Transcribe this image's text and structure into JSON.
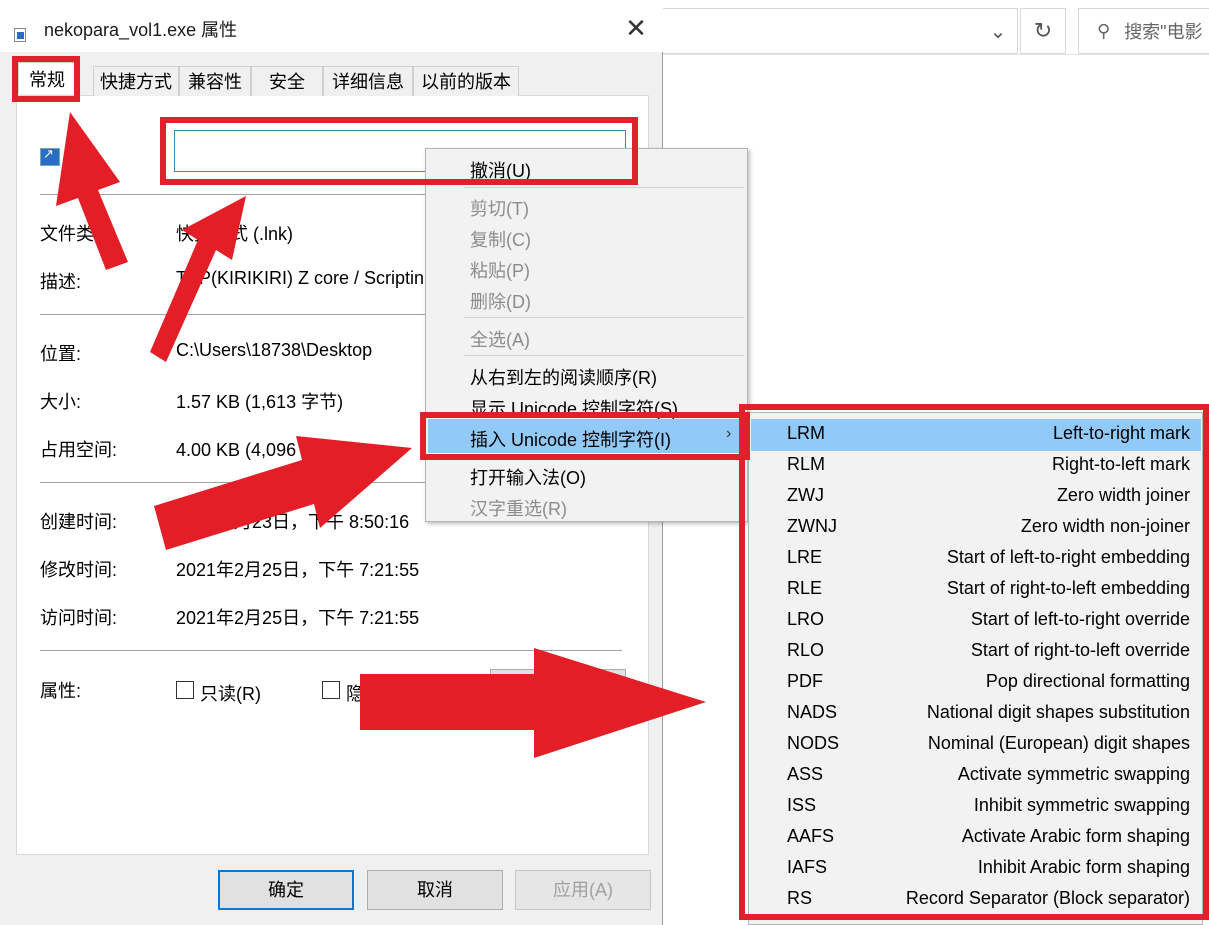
{
  "dialog": {
    "title": "nekopara_vol1.exe 属性",
    "close_glyph": "✕",
    "tabs": [
      "常规",
      "快捷方式",
      "兼容性",
      "安全",
      "详细信息",
      "以前的版本"
    ],
    "fields": {
      "file_type_label": "文件类",
      "file_type_value": "快捷方式 (.lnk)",
      "desc_label": "描述:",
      "desc_value": "TVP(KIRIKIRI) Z core / Scriptin",
      "location_label": "位置:",
      "location_value": "C:\\Users\\18738\\Desktop",
      "size_label": "大小:",
      "size_value": "1.57 KB (1,613 字节)",
      "disk_label": "占用空间:",
      "disk_value": "4.00 KB (4,096 字节)",
      "created_label": "创建时间:",
      "created_value": "2月23日，下午 8:50:16",
      "modified_label": "修改时间:",
      "modified_value": "2021年2月25日，下午 7:21:55",
      "accessed_label": "访问时间:",
      "accessed_value": "2021年2月25日，下午 7:21:55",
      "attr_label": "属性:",
      "readonly_label": "只读(R)",
      "hidden_label": "隐"
    },
    "buttons": {
      "ok": "确定",
      "cancel": "取消",
      "apply": "应用(A)"
    }
  },
  "explorer": {
    "chevron": "⌄",
    "refresh": "↻",
    "search_icon": "⚲",
    "search_placeholder": "搜索\"电影"
  },
  "context_menu": {
    "undo": "撤消(U)",
    "cut": "剪切(T)",
    "copy": "复制(C)",
    "paste": "粘贴(P)",
    "delete": "删除(D)",
    "select_all": "全选(A)",
    "rtl": "从右到左的阅读顺序(R)",
    "show_unicode": "显示 Unicode 控制字符(S)",
    "insert_unicode": "插入 Unicode 控制字符(I)",
    "submenu_arrow": "›",
    "open_ime": "打开输入法(O)",
    "reconvert": "汉字重选(R)"
  },
  "submenu": [
    {
      "code": "LRM",
      "desc": "Left-to-right mark"
    },
    {
      "code": "RLM",
      "desc": "Right-to-left mark"
    },
    {
      "code": "ZWJ",
      "desc": "Zero width joiner"
    },
    {
      "code": "ZWNJ",
      "desc": "Zero width non-joiner"
    },
    {
      "code": "LRE",
      "desc": "Start of left-to-right embedding"
    },
    {
      "code": "RLE",
      "desc": "Start of right-to-left embedding"
    },
    {
      "code": "LRO",
      "desc": "Start of left-to-right override"
    },
    {
      "code": "RLO",
      "desc": "Start of right-to-left override"
    },
    {
      "code": "PDF",
      "desc": "Pop directional formatting"
    },
    {
      "code": "NADS",
      "desc": "National digit shapes substitution"
    },
    {
      "code": "NODS",
      "desc": "Nominal (European) digit shapes"
    },
    {
      "code": "ASS",
      "desc": "Activate symmetric swapping"
    },
    {
      "code": "ISS",
      "desc": "Inhibit symmetric swapping"
    },
    {
      "code": "AAFS",
      "desc": "Activate Arabic form shaping"
    },
    {
      "code": "IAFS",
      "desc": "Inhibit Arabic form shaping"
    },
    {
      "code": "RS",
      "desc": "Record Separator (Block separator)"
    }
  ],
  "colors": {
    "annotation_red": "#e0202a",
    "highlight_blue": "#91c9f7",
    "focus_blue": "#0078d7"
  }
}
